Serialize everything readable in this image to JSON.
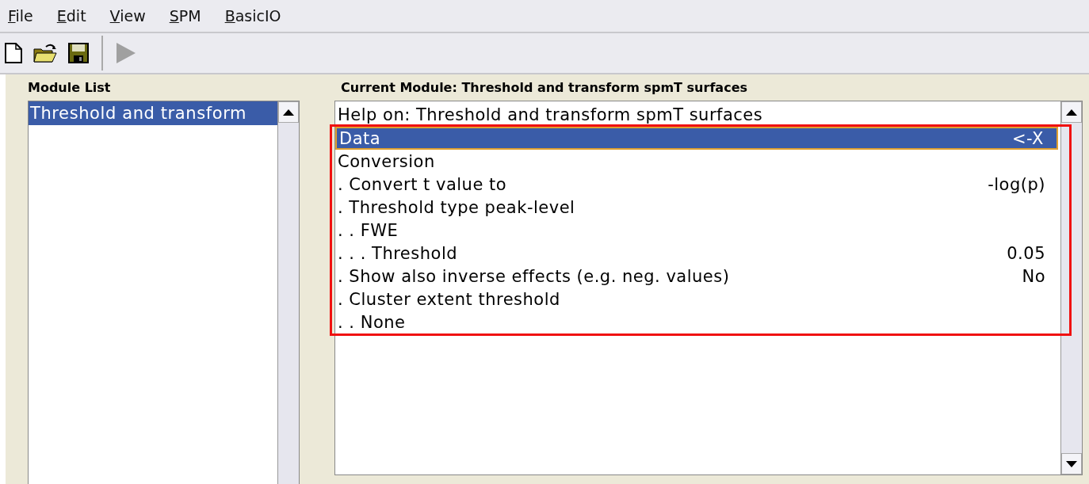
{
  "menu": [
    {
      "label": "File"
    },
    {
      "label": "Edit"
    },
    {
      "label": "View"
    },
    {
      "label": "SPM"
    },
    {
      "label": "BasicIO"
    }
  ],
  "toolbar": [
    {
      "kind": "new",
      "disabled": false
    },
    {
      "kind": "open",
      "disabled": false
    },
    {
      "kind": "save",
      "disabled": false
    },
    {
      "kind": "separator"
    },
    {
      "kind": "run",
      "disabled": true
    }
  ],
  "module_list": {
    "title": "Module List",
    "items": [
      {
        "label": "Threshold and transform",
        "selected": true
      }
    ]
  },
  "current_module": {
    "title": "Current Module: Threshold and transform spmT surfaces",
    "rows": [
      {
        "label": "Help on: Threshold and transform spmT surfaces",
        "selected": false
      }
    ],
    "annotation": {
      "kind": "highlight-frame",
      "rows": [
        {
          "label": "Data",
          "value": "<-X",
          "selected": true
        },
        {
          "label": "Conversion",
          "selected": false
        },
        {
          "label": ". Convert t value to",
          "value": "-log(p)",
          "selected": false
        },
        {
          "label": ". Threshold type peak-level",
          "selected": false
        },
        {
          "label": ". . FWE",
          "selected": false
        },
        {
          "label": ". . . Threshold",
          "value": "0.05",
          "selected": false
        },
        {
          "label": ". Show also inverse effects (e.g. neg. values)",
          "value": "No",
          "selected": false
        },
        {
          "label": ". Cluster extent threshold",
          "selected": false
        },
        {
          "label": ". . None",
          "selected": false
        }
      ]
    }
  }
}
